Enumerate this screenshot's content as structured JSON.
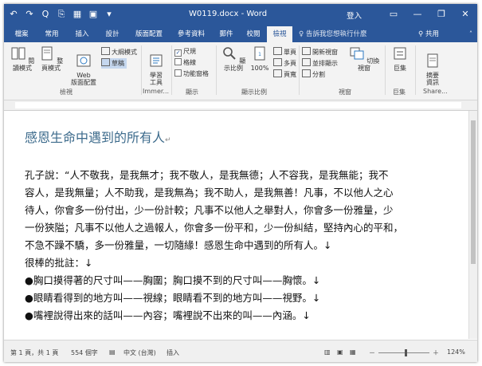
{
  "window": {
    "title": "W0119.docx - Word",
    "login": "登入",
    "minimize": "—",
    "restore": "❐",
    "close": "✕"
  },
  "qat": [
    "↶",
    "↷",
    "Q",
    "⎘",
    "▦",
    "▣",
    "▾"
  ],
  "tabs": [
    "檔案",
    "常用",
    "插入",
    "設計",
    "版面配置",
    "參考資料",
    "郵件",
    "校閱",
    "檢視"
  ],
  "tell_me": "告訴我您想執行什麼",
  "share": "共用",
  "ribbon": {
    "views": {
      "read_mode": "閱讀模式",
      "print_layout": "整頁模式",
      "web_layout": "Web\n版面配置",
      "outline": "大綱模式",
      "draft": "草稿",
      "group": "檢視"
    },
    "immersive": {
      "learning_tools": "學習\n工具",
      "group": "Immer..."
    },
    "show": {
      "ruler": "尺規",
      "gridlines": "格線",
      "nav_pane": "功能窗格",
      "group": "顯示",
      "ruler_checked": true
    },
    "zoom": {
      "zoom": "顯示比例",
      "percent": "100%",
      "one_page": "單頁",
      "multi_page": "多頁",
      "page_width": "頁寬",
      "group": "顯示比例"
    },
    "window": {
      "new_window": "開新視窗",
      "arrange_all": "並排顯示",
      "split": "分割",
      "switch": "切換視窗",
      "group": "視窗"
    },
    "macros": {
      "macros": "巨集",
      "group": "巨集"
    },
    "sharepoint": {
      "properties": "摘要\n資訊",
      "group": "Share..."
    }
  },
  "document": {
    "heading": "感恩生命中遇到的所有人",
    "lines": [
      "孔子說：“人不敬我，是我無才；我不敬人，是我無德；人不容我，是我無能；我不",
      "容人，是我無量；人不助我，是我無為；我不助人，是我無善！凡事，不以他人之心",
      "待人，你會多一份付出，少一份計較；凡事不以他人之舉對人，你會多一份雅量，少",
      "一份狹隘；凡事不以他人之過報人，你會多一份平和，少一份糾結，堅持內心的平和，",
      "不急不躁不驕，多一份雅量，一切隨緣！感恩生命中遇到的所有人。↓",
      "很棒的批註：↓",
      "●胸口摸得著的尺寸叫——胸圍；胸口摸不到的尺寸叫——胸懷。↓",
      "●眼睛看得到的地方叫——視線；眼睛看不到的地方叫——視野。↓",
      "●嘴裡說得出來的話叫——內容；嘴裡說不出來的叫——內涵。↓"
    ],
    "heading_mark": "↵"
  },
  "statusbar": {
    "page": "第 1 頁，共 1 頁",
    "words": "554 個字",
    "lang": "中文 (台灣)",
    "mode": "插入",
    "zoom": "124%",
    "minus": "－",
    "plus": "＋"
  },
  "colors": {
    "brand": "#2b579a",
    "heading": "#3d6b8c"
  }
}
